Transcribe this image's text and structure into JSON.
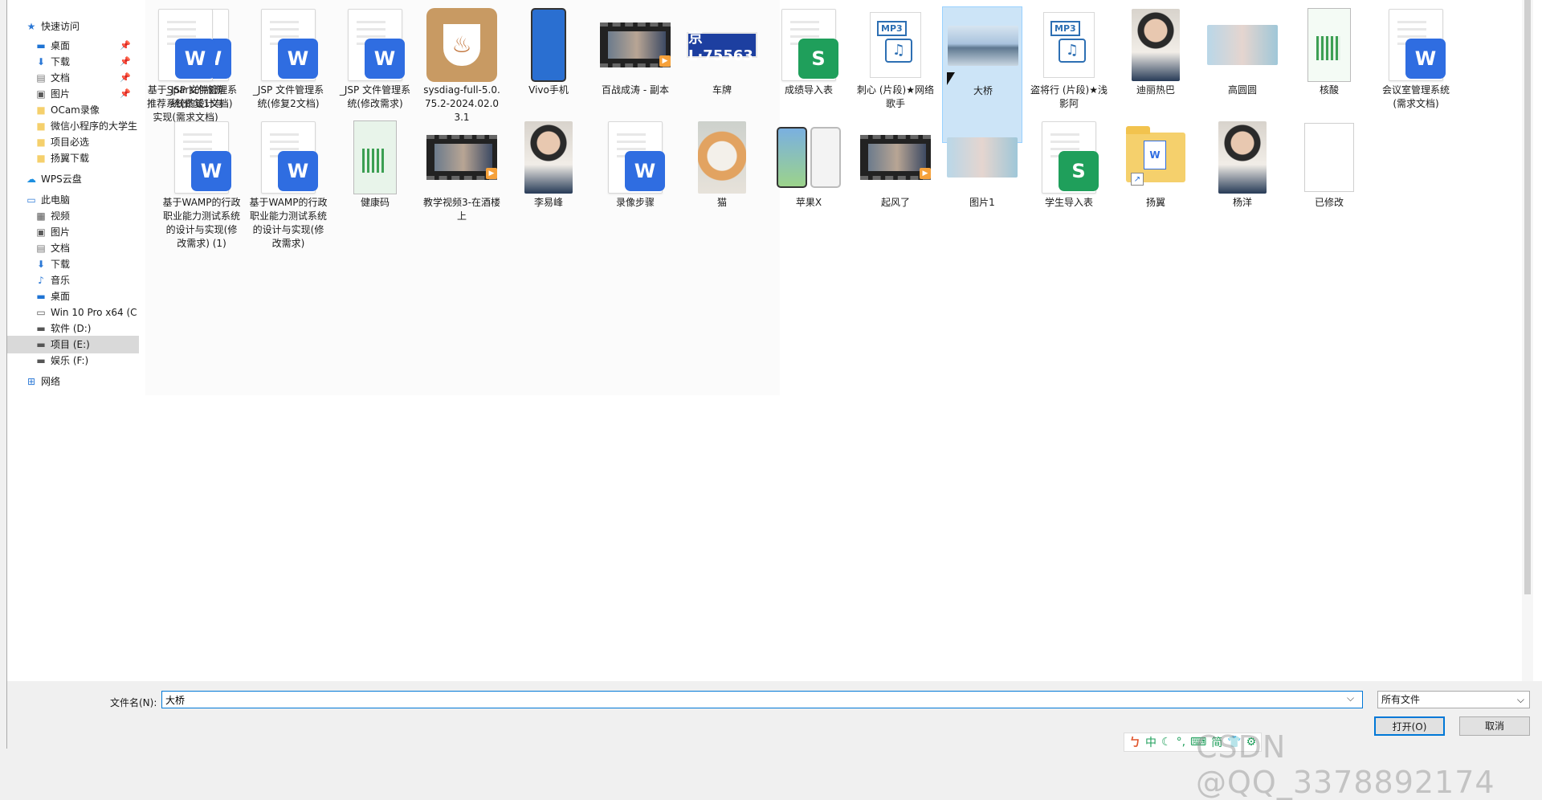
{
  "nav": {
    "items": [
      {
        "label": "快速访问",
        "icon": "star-icon",
        "pinned": false
      },
      {
        "label": "桌面",
        "icon": "desktop-icon",
        "pinned": true
      },
      {
        "label": "下载",
        "icon": "download-arrow-icon",
        "pinned": true
      },
      {
        "label": "文档",
        "icon": "document-icon",
        "pinned": true
      },
      {
        "label": "图片",
        "icon": "picture-icon",
        "pinned": true
      },
      {
        "label": "OCam录像",
        "icon": "folder-icon",
        "pinned": false
      },
      {
        "label": "微信小程序的大学生",
        "icon": "folder-icon",
        "pinned": false
      },
      {
        "label": "项目必选",
        "icon": "folder-icon",
        "pinned": false
      },
      {
        "label": "扬翼下载",
        "icon": "folder-icon",
        "pinned": false
      },
      {
        "label": "WPS云盘",
        "icon": "cloud-icon",
        "pinned": false
      },
      {
        "label": "此电脑",
        "icon": "computer-icon",
        "pinned": false
      },
      {
        "label": "视频",
        "icon": "video-icon",
        "pinned": false
      },
      {
        "label": "图片",
        "icon": "picture-icon",
        "pinned": false
      },
      {
        "label": "文档",
        "icon": "document-icon",
        "pinned": false
      },
      {
        "label": "下载",
        "icon": "download-arrow-icon",
        "pinned": false
      },
      {
        "label": "音乐",
        "icon": "music-note-icon",
        "pinned": false
      },
      {
        "label": "桌面",
        "icon": "desktop-icon",
        "pinned": false
      },
      {
        "label": "Win 10 Pro x64 (C",
        "icon": "drive-windows-icon",
        "pinned": false
      },
      {
        "label": "软件 (D:)",
        "icon": "drive-icon",
        "pinned": false
      },
      {
        "label": "项目 (E:)",
        "icon": "drive-icon",
        "pinned": false,
        "selected": true
      },
      {
        "label": "娱乐 (F:)",
        "icon": "drive-icon",
        "pinned": false
      },
      {
        "label": "网络",
        "icon": "network-icon",
        "pinned": false
      }
    ]
  },
  "files": [
    {
      "name": "_JSP 文件管理系统(修复1文档)",
      "kind": "word"
    },
    {
      "name": "_JSP 文件管理系统(修复2文档)",
      "kind": "word"
    },
    {
      "name": "_JSP 文件管理系统(修改需求)",
      "kind": "word"
    },
    {
      "name": "sysdiag-full-5.0.75.2-2024.02.03.1",
      "kind": "installer"
    },
    {
      "name": "Vivo手机",
      "kind": "photo-phone"
    },
    {
      "name": "百战成涛 - 副本",
      "kind": "video"
    },
    {
      "name": "车牌",
      "kind": "plate",
      "plate_text": "京L·75563"
    },
    {
      "name": "成绩导入表",
      "kind": "sheet"
    },
    {
      "name": "刺心 (片段)★网络歌手",
      "kind": "mp3"
    },
    {
      "name": "大桥",
      "kind": "photo-bridge",
      "selected": true
    },
    {
      "name": "盗将行 (片段)★浅影阿",
      "kind": "mp3"
    },
    {
      "name": "迪丽热巴",
      "kind": "photo-person"
    },
    {
      "name": "高圆圆",
      "kind": "photo-wide"
    },
    {
      "name": "核酸",
      "kind": "photo-app"
    },
    {
      "name": "会议室管理系统(需求文档)",
      "kind": "word"
    },
    {
      "name": "基于Spark的旅游推荐系统的设计与实现(需求文档)",
      "kind": "word"
    },
    {
      "name": "基于WAMP的行政职业能力测试系统的设计与实现(修改需求) (1)",
      "kind": "word"
    },
    {
      "name": "基于WAMP的行政职业能力测试系统的设计与实现(修改需求)",
      "kind": "word"
    },
    {
      "name": "健康码",
      "kind": "qr"
    },
    {
      "name": "教学视频3-在酒楼上",
      "kind": "video"
    },
    {
      "name": "李易峰",
      "kind": "photo-person"
    },
    {
      "name": "录像步骤",
      "kind": "word"
    },
    {
      "name": "猫",
      "kind": "photo-cat"
    },
    {
      "name": "苹果X",
      "kind": "photo-iphone"
    },
    {
      "name": "起风了",
      "kind": "video"
    },
    {
      "name": "图片1",
      "kind": "photo-wide"
    },
    {
      "name": "学生导入表",
      "kind": "sheet"
    },
    {
      "name": "扬翼",
      "kind": "folder-shortcut"
    },
    {
      "name": "杨洋",
      "kind": "photo-person"
    },
    {
      "name": "已修改",
      "kind": "plain"
    }
  ],
  "footer": {
    "filename_label": "文件名(N):",
    "filename_value": "大桥",
    "filter_value": "所有文件",
    "open_label": "打开(O)",
    "cancel_label": "取消"
  },
  "ime": {
    "items": [
      "中",
      "简"
    ]
  },
  "watermark": "CSDN @QQ_3378892174",
  "colors": {
    "selected_bg": "#cce4f7",
    "selected_border": "#99d1ff",
    "word_badge": "#2f6de1",
    "sheet_badge": "#1f9f5b",
    "focus_border": "#0078d7"
  }
}
